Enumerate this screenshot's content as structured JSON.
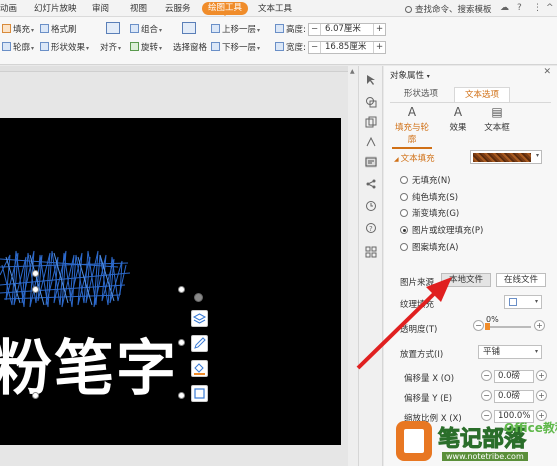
{
  "tabs": [
    "动画",
    "幻灯片放映",
    "审阅",
    "视图",
    "云服务",
    "绘图工具",
    "文本工具"
  ],
  "active_tab": "绘图工具",
  "search": {
    "placeholder": "查找命令、搜索模板"
  },
  "ribbon": {
    "fill": "填充",
    "style": "格式刷",
    "outline": "轮廓",
    "shape_effect": "形状效果",
    "align": "对齐",
    "group": "组合",
    "rotate": "旋转",
    "selection_pane": "选择窗格",
    "bring_forward": "上移一层",
    "send_backward": "下移一层",
    "height_label": "高度:",
    "height_value": "6.07厘米",
    "width_label": "宽度:",
    "width_value": "16.85厘米"
  },
  "slide": {
    "text": "粉笔字"
  },
  "panel": {
    "title": "对象属性",
    "tabs": [
      "形状选项",
      "文本选项"
    ],
    "subtabs": [
      {
        "icon": "A",
        "label": "填充与轮廓"
      },
      {
        "icon": "A",
        "label": "效果"
      },
      {
        "icon": "▤",
        "label": "文本框"
      }
    ],
    "section": "文本填充",
    "fill_options": [
      {
        "label": "无填充(N)",
        "checked": false
      },
      {
        "label": "纯色填充(S)",
        "checked": false
      },
      {
        "label": "渐变填充(G)",
        "checked": false
      },
      {
        "label": "图片或纹理填充(P)",
        "checked": true
      },
      {
        "label": "图案填充(A)",
        "checked": false
      }
    ],
    "picture_source_label": "图片来源",
    "local_file": "本地文件",
    "online_file": "在线文件",
    "texture_fill_label": "纹理填充",
    "transparency_label": "透明度(T)",
    "transparency_value": "0%",
    "transparency": 0,
    "placement_label": "放置方式(I)",
    "placement_value": "平铺",
    "offset_x_label": "偏移量 X (O)",
    "offset_x_value": "0.0磅",
    "offset_y_label": "偏移量 Y (E)",
    "offset_y_value": "0.0磅",
    "scale_x_label": "缩放比例 X (X)",
    "scale_x_value": "100.0%"
  },
  "watermark": {
    "brand": "笔记部落",
    "office": "Office教程网",
    "url": "www.notetribe.com"
  },
  "colors": {
    "accent": "#f08c2a",
    "slide_bg": "#000000",
    "scribble": "#2f6fd6"
  }
}
